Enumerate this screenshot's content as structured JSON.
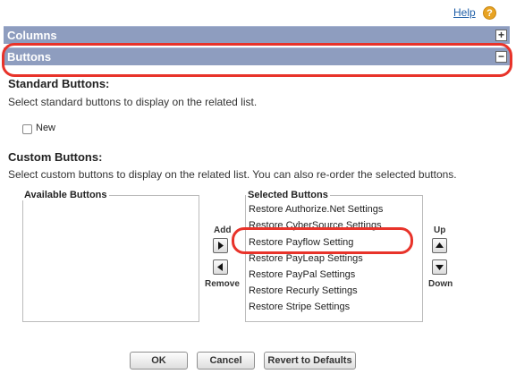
{
  "help": {
    "label": "Help",
    "icon": "help-question-icon",
    "icon_glyph": "?"
  },
  "sections": {
    "columns": {
      "title": "Columns",
      "toggle": "+"
    },
    "buttons": {
      "title": "Buttons",
      "toggle": "−"
    }
  },
  "standard_buttons": {
    "heading": "Standard Buttons:",
    "description": "Select standard buttons to display on the related list.",
    "options": [
      {
        "label": "New",
        "checked": false
      }
    ]
  },
  "custom_buttons": {
    "heading": "Custom Buttons:",
    "description": "Select custom buttons to display on the related list. You can also re-order the selected buttons.",
    "available": {
      "title": "Available Buttons",
      "items": []
    },
    "selected": {
      "title": "Selected Buttons",
      "items": [
        "Restore Authorize.Net Settings",
        "Restore CyberSource Settings",
        "Restore Payflow Setting",
        "Restore PayLeap Settings",
        "Restore PayPal Settings",
        "Restore Recurly Settings",
        "Restore Stripe Settings"
      ]
    },
    "add_label": "Add",
    "remove_label": "Remove",
    "up_label": "Up",
    "down_label": "Down"
  },
  "footer": {
    "ok": "OK",
    "cancel": "Cancel",
    "revert": "Revert to Defaults"
  },
  "colors": {
    "section_bar": "#8e9dbf",
    "callout": "#e8332a",
    "help_icon": "#e8a323"
  }
}
